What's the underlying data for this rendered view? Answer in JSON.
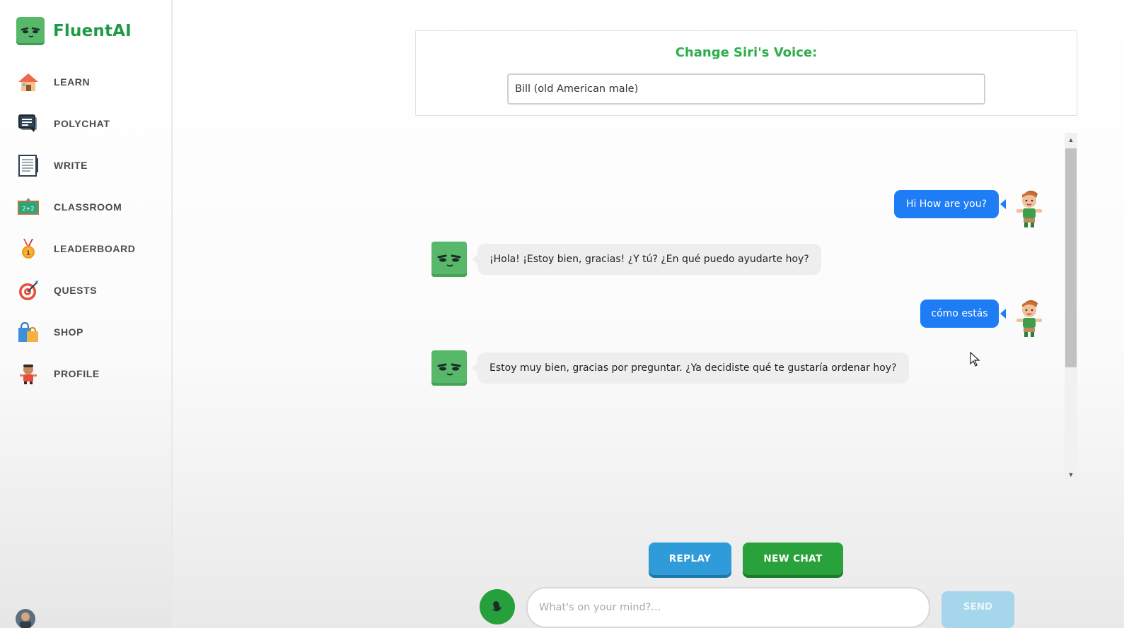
{
  "app": {
    "name": "FluentAI"
  },
  "sidebar": {
    "items": [
      {
        "label": "LEARN",
        "icon": "house-icon"
      },
      {
        "label": "POLYCHAT",
        "icon": "chat-bubbles-icon"
      },
      {
        "label": "WRITE",
        "icon": "notebook-icon"
      },
      {
        "label": "CLASSROOM",
        "icon": "chalkboard-icon"
      },
      {
        "label": "LEADERBOARD",
        "icon": "medal-icon"
      },
      {
        "label": "QUESTS",
        "icon": "target-icon"
      },
      {
        "label": "SHOP",
        "icon": "shopping-bags-icon"
      },
      {
        "label": "PROFILE",
        "icon": "profile-character-icon"
      }
    ]
  },
  "voice": {
    "title": "Change Siri's Voice:",
    "selected": "Bill (old American male)"
  },
  "chat": {
    "messages": [
      {
        "sender": "user",
        "text": "Hi How are you?"
      },
      {
        "sender": "bot",
        "text": "¡Hola! ¡Estoy bien, gracias! ¿Y tú? ¿En qué puedo ayudarte hoy?"
      },
      {
        "sender": "user",
        "text": "cómo estás"
      },
      {
        "sender": "bot",
        "text": "Estoy muy bien, gracias por preguntar. ¿Ya decidiste qué te gustaría ordenar hoy?"
      }
    ]
  },
  "controls": {
    "replay_label": "REPLAY",
    "new_chat_label": "NEW CHAT",
    "input_placeholder": "What's on your mind?...",
    "send_label": "SEND"
  },
  "colors": {
    "brand_green": "#1f9a48",
    "user_bubble": "#1e7cf5",
    "bot_bubble": "#eeeeee",
    "replay_blue": "#2f9bd8",
    "new_chat_green": "#2aa23c",
    "send_disabled": "#a5d6ec"
  }
}
